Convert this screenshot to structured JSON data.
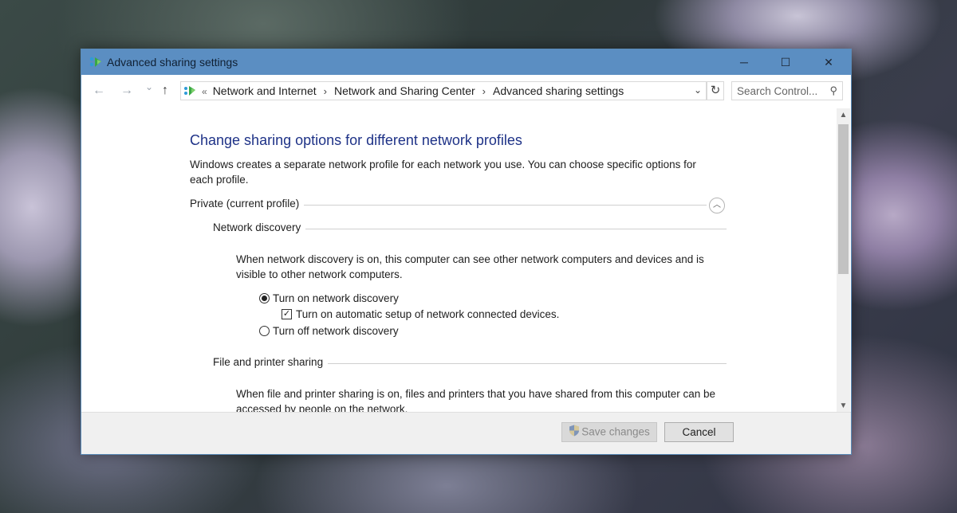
{
  "window": {
    "title": "Advanced sharing settings",
    "controls": {
      "minimize": "─",
      "maximize": "☐",
      "close": "✕"
    }
  },
  "navigation": {
    "back": "←",
    "forward": "→",
    "recent": "⌄",
    "up": "↑",
    "breadcrumb_lead": "«",
    "breadcrumbs": [
      "Network and Internet",
      "Network and Sharing Center",
      "Advanced sharing settings"
    ],
    "separator": "›",
    "dropdown": "⌄",
    "refresh": "↻",
    "search_placeholder": "Search Control...",
    "search_icon": "⚲"
  },
  "content": {
    "heading": "Change sharing options for different network profiles",
    "intro": "Windows creates a separate network profile for each network you use. You can choose specific options for each profile.",
    "profile": {
      "label": "Private (current profile)",
      "collapse_glyph": "︿"
    },
    "network_discovery": {
      "label": "Network discovery",
      "description": "When network discovery is on, this computer can see other network computers and devices and is visible to other network computers.",
      "options": {
        "turn_on": "Turn on network discovery",
        "auto_setup": "Turn on automatic setup of network connected devices.",
        "turn_off": "Turn off network discovery"
      },
      "selected": "turn_on",
      "auto_setup_checked": true
    },
    "file_printer_sharing": {
      "label": "File and printer sharing",
      "description": "When file and printer sharing is on, files and printers that you have shared from this computer can be accessed by people on the network."
    }
  },
  "footer": {
    "save_label": "Save changes",
    "cancel_label": "Cancel"
  },
  "scrollbar": {
    "up": "▲",
    "down": "▼"
  },
  "icons": {
    "app": "network-sharing-icon",
    "shield": "uac-shield-icon"
  },
  "colors": {
    "titlebar": "#5b8ec2",
    "heading": "#1e3287"
  }
}
